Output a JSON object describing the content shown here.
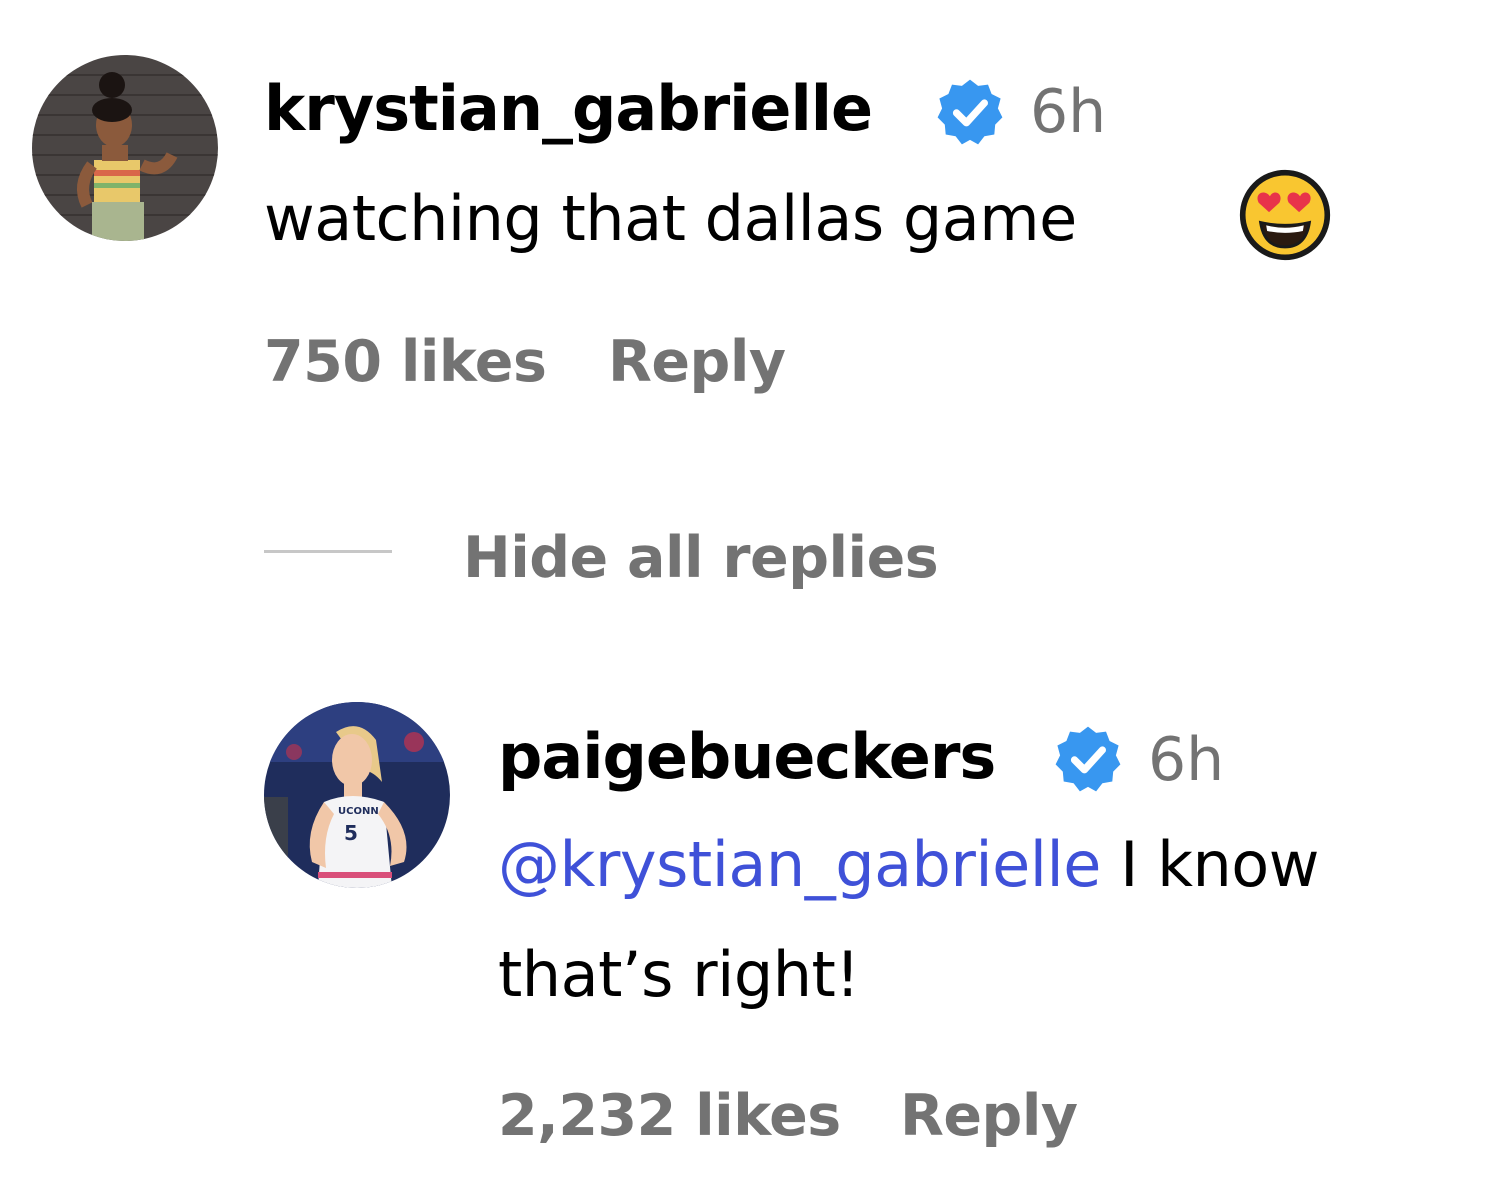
{
  "comment": {
    "username": "krystian_gabrielle",
    "time": "6h",
    "text": "watching that dallas game",
    "emoji": "smiling-face-with-heart-eyes",
    "likes": "750 likes",
    "reply_label": "Reply"
  },
  "thread": {
    "hide_replies_label": "Hide all replies"
  },
  "reply": {
    "username": "paigebueckers",
    "time": "6h",
    "mention": "@krystian_gabrielle",
    "text_line1": " I know",
    "text_line2": "that’s right!",
    "likes": "2,232 likes",
    "reply_label": "Reply",
    "avatar_jersey_text": "UCONN",
    "avatar_jersey_number": "5"
  },
  "colors": {
    "verified_badge": "#3897f0",
    "meta_gray": "#737373",
    "mention_blue": "#3f51d8"
  }
}
